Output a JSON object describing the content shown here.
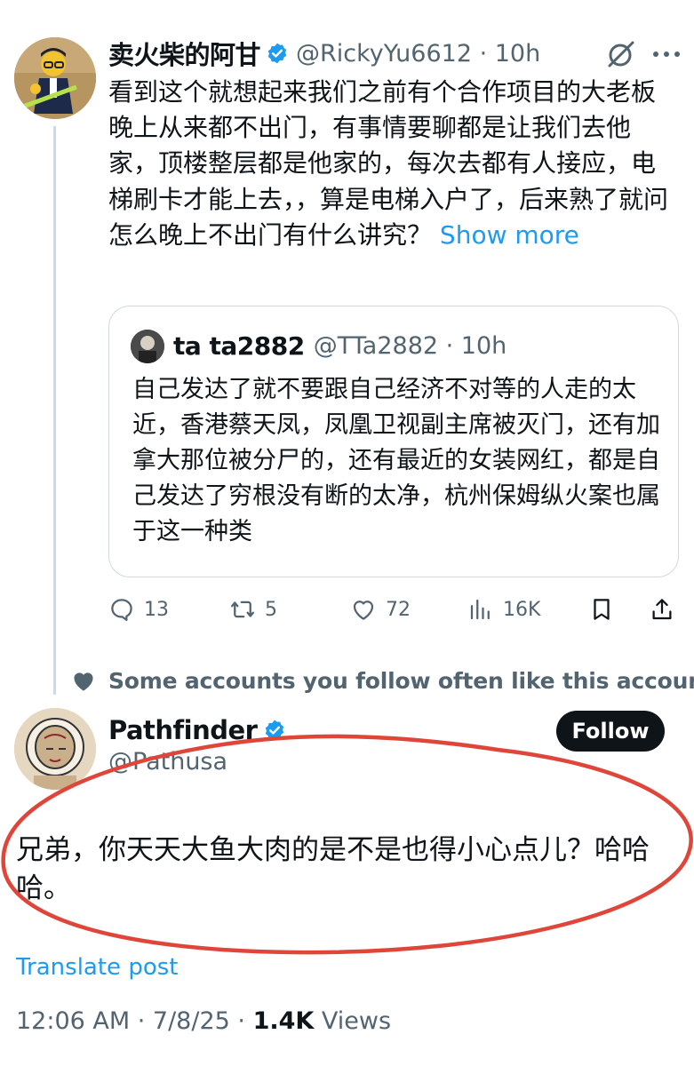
{
  "tweet": {
    "author_name": "卖火柴的阿甘",
    "handle_time": "@RickyYu6612 · 10h",
    "body": "看到这个就想起来我们之前有个合作项目的大老板晚上从来都不出门，有事情要聊都是让我们去他家，顶楼整层都是他家的，每次去都有人接应，电梯刷卡才能上去，，算是电梯入户了，后来熟了就问怎么晚上不出门有什么讲究？",
    "show_more": "Show more",
    "quote": {
      "author_name": "ta ta2882",
      "handle_time": "@TTa2882 · 10h",
      "body": "自己发达了就不要跟自己经济不对等的人走的太近，香港蔡天凤，凤凰卫视副主席被灭门，还有加拿大那位被分尸的，还有最近的女装网红，都是自己发达了穷根没有断的太净，杭州保姆纵火案也属于这一种类"
    },
    "actions": {
      "replies": "13",
      "reposts": "5",
      "likes": "72",
      "views": "16K"
    }
  },
  "social_context": "Some accounts you follow often like this account",
  "reply": {
    "author_name": "Pathfinder",
    "handle": "@Pathusa",
    "follow_label": "Follow",
    "body": "兄弟，你天天大鱼大肉的是不是也得小心点儿？哈哈哈。",
    "translate_label": "Translate post",
    "timestamp": "12:06 AM · 7/8/25 · ",
    "views_count": "1.4K",
    "views_label": " Views"
  },
  "colors": {
    "accent": "#1d9bf0",
    "text": "#0f1419",
    "secondary": "#536471",
    "annotation": "#e0453a"
  }
}
